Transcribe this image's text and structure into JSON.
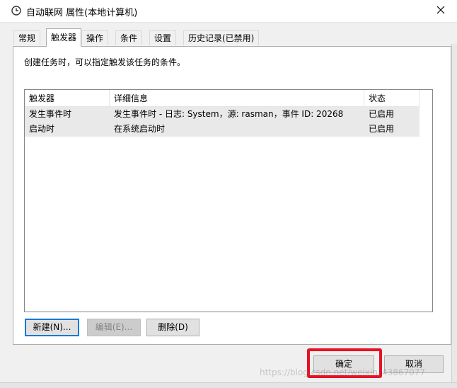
{
  "window": {
    "title": "自动联网 属性(本地计算机)",
    "icon": "clock-icon",
    "close_glyph": "✕"
  },
  "tabs": [
    {
      "label": "常规",
      "active": false
    },
    {
      "label": "触发器",
      "active": true
    },
    {
      "label": "操作",
      "active": false
    },
    {
      "label": "条件",
      "active": false
    },
    {
      "label": "设置",
      "active": false
    },
    {
      "label": "历史记录(已禁用)",
      "active": false
    }
  ],
  "triggers_panel": {
    "description": "创建任务时，可以指定触发该任务的条件。",
    "columns": [
      "触发器",
      "详细信息",
      "状态"
    ],
    "rows": [
      {
        "trigger": "发生事件时",
        "details": "发生事件时 - 日志: System，源: rasman，事件 ID: 20268",
        "status": "已启用"
      },
      {
        "trigger": "启动时",
        "details": "在系统启动时",
        "status": "已启用"
      }
    ],
    "buttons": {
      "new": "新建(N)...",
      "edit": "编辑(E)...",
      "delete": "删除(D)"
    }
  },
  "dialog_buttons": {
    "ok": "确定",
    "cancel": "取消"
  },
  "watermark": "https://blog.csdn.net/weixin_43867077",
  "colors": {
    "highlight": "#e81123",
    "focus_border": "#0078d7",
    "selected_row": "#e9e9e9"
  }
}
